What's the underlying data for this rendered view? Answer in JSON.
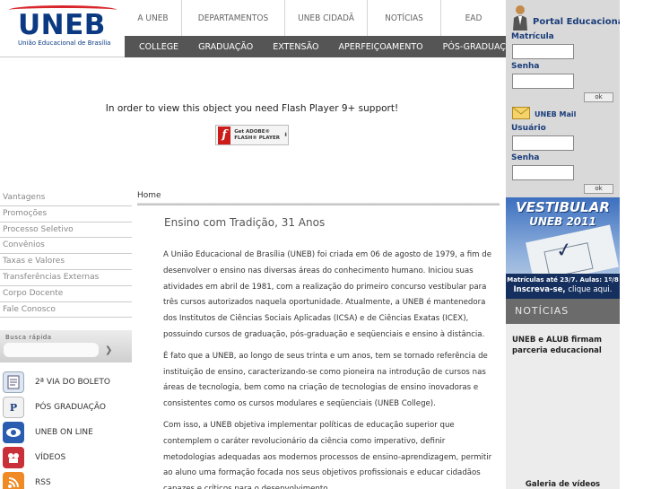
{
  "brand": {
    "name": "UNEB",
    "subtitle": "União Educacional de Brasília"
  },
  "top_nav": [
    "A UNEB",
    "DEPARTAMENTOS",
    "UNEB CIDADÃ",
    "NOTÍCIAS",
    "EAD"
  ],
  "sub_nav": [
    "COLLEGE",
    "GRADUAÇÃO",
    "EXTENSÃO",
    "APERFEIÇOAMENTO",
    "PÓS-GRADUAÇÃO"
  ],
  "portal": {
    "title": "Portal Educacional",
    "matricula_label": "Matrícula",
    "senha_label": "Senha",
    "ok_label": "ok"
  },
  "mail": {
    "title": "UNEB Mail",
    "usuario_label": "Usuário",
    "senha_label": "Senha",
    "ok_label": "ok"
  },
  "flash": {
    "message": "In order to view this object you need Flash Player 9+ support!",
    "button_line1": "Get ADOBE®",
    "button_line2": "FLASH® PLAYER"
  },
  "left_nav": [
    "Vantagens",
    "Promoções",
    "Processo Seletivo",
    "Convênios",
    "Taxas e Valores",
    "Transferências Externas",
    "Corpo Docente",
    "Fale Conosco"
  ],
  "quick_search": {
    "label": "Busca rápida",
    "go": "❯"
  },
  "quick_links": [
    {
      "label": "2ª VIA DO BOLETO",
      "icon": "document-icon"
    },
    {
      "label": "PÓS GRADUAÇÃO",
      "icon": "p-logo-icon"
    },
    {
      "label": "UNEB ON LINE",
      "icon": "eye-icon"
    },
    {
      "label": "VÍDEOS",
      "icon": "video-icon"
    },
    {
      "label": "RSS",
      "icon": "rss-icon"
    }
  ],
  "breadcrumb": "Home",
  "main_title": "Ensino com Tradição, 31 Anos",
  "article": [
    "A União Educacional de Brasília (UNEB) foi criada em 06 de agosto de 1979, a fim de desenvolver o ensino nas diversas áreas do conhecimento humano. Iniciou suas atividades em abril de 1981, com a realização do primeiro concurso vestibular para três cursos autorizados naquela oportunidade. Atualmente, a UNEB é mantenedora dos Institutos de Ciências Sociais Aplicadas (ICSA) e de Ciências Exatas (ICEX), possuindo cursos de graduação, pós-graduação e seqüenciais e ensino à distância.",
    "É fato que a UNEB, ao longo de seus trinta e um anos, tem se tornado referência de instituição de ensino, caracterizando-se como pioneira na introdução de cursos nas áreas de tecnologia, bem como na criação de tecnologias de ensino inovadoras e consistentes como os cursos modulares e seqüenciais (UNEB College).",
    "Com isso, a UNEB objetiva implementar políticas de educação superior que contemplem o caráter revolucionário da ciência como imperativo, definir metodologias adequadas aos modernos processos de ensino-aprendizagem, permitir ao aluno uma formação focada nos seus objetivos profissionais e educar cidadãos capazes e críticos para o desenvolvimento"
  ],
  "banner": {
    "title": "VESTIBULAR",
    "subtitle": "UNEB 2011",
    "line1": "Matrículas até 23/7. Aulas: 1º/8",
    "line2_strong": "Inscreva-se,",
    "line2_rest": " clique aqui."
  },
  "news": {
    "heading": "NOTÍCIAS",
    "headline": "UNEB e ALUB firmam parceria educacional",
    "gallery": "Galeria de vídeos"
  }
}
